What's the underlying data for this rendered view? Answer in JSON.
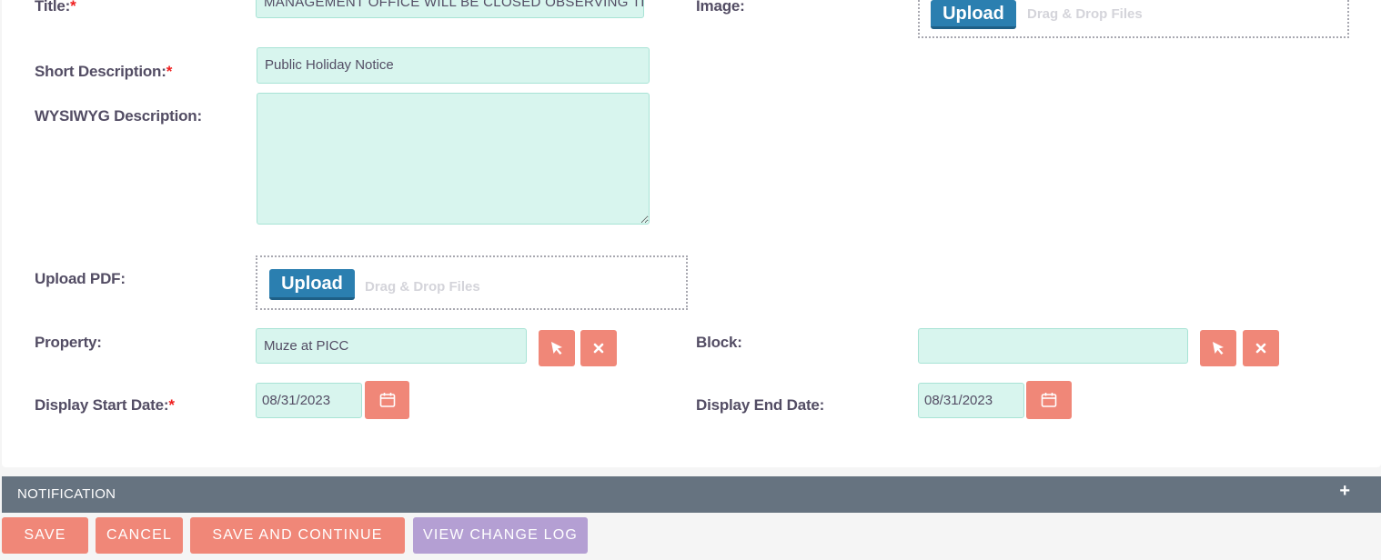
{
  "form": {
    "title": {
      "label": "Title:",
      "required": "*",
      "value": "MANAGEMENT OFFICE WILL BE CLOSED OBSERVING THE"
    },
    "image": {
      "label": "Image:",
      "upload_label": "Upload",
      "drag_text": "Drag & Drop Files"
    },
    "short_description": {
      "label": "Short Description:",
      "required": "*",
      "value": "Public Holiday Notice"
    },
    "wysiwyg": {
      "label": "WYSIWYG Description:",
      "value": ""
    },
    "upload_pdf": {
      "label": "Upload PDF:",
      "upload_label": "Upload",
      "drag_text": "Drag & Drop Files"
    },
    "property": {
      "label": "Property:",
      "value": "Muze at PICC"
    },
    "block": {
      "label": "Block:",
      "value": ""
    },
    "display_start": {
      "label": "Display Start Date:",
      "required": "*",
      "value": "08/31/2023"
    },
    "display_end": {
      "label": "Display End Date:",
      "value": "08/31/2023"
    }
  },
  "notification": {
    "title": "NOTIFICATION",
    "toggle": "+"
  },
  "actions": {
    "save": "SAVE",
    "cancel": "CANCEL",
    "save_continue": "SAVE AND CONTINUE",
    "view_log": "VIEW CHANGE LOG"
  },
  "colors": {
    "field_bg": "#d8f5ee",
    "accent_salmon": "#f08778",
    "upload_blue": "#2b7fb0",
    "purple_button": "#b49fd3",
    "bar_gray": "#667380"
  }
}
